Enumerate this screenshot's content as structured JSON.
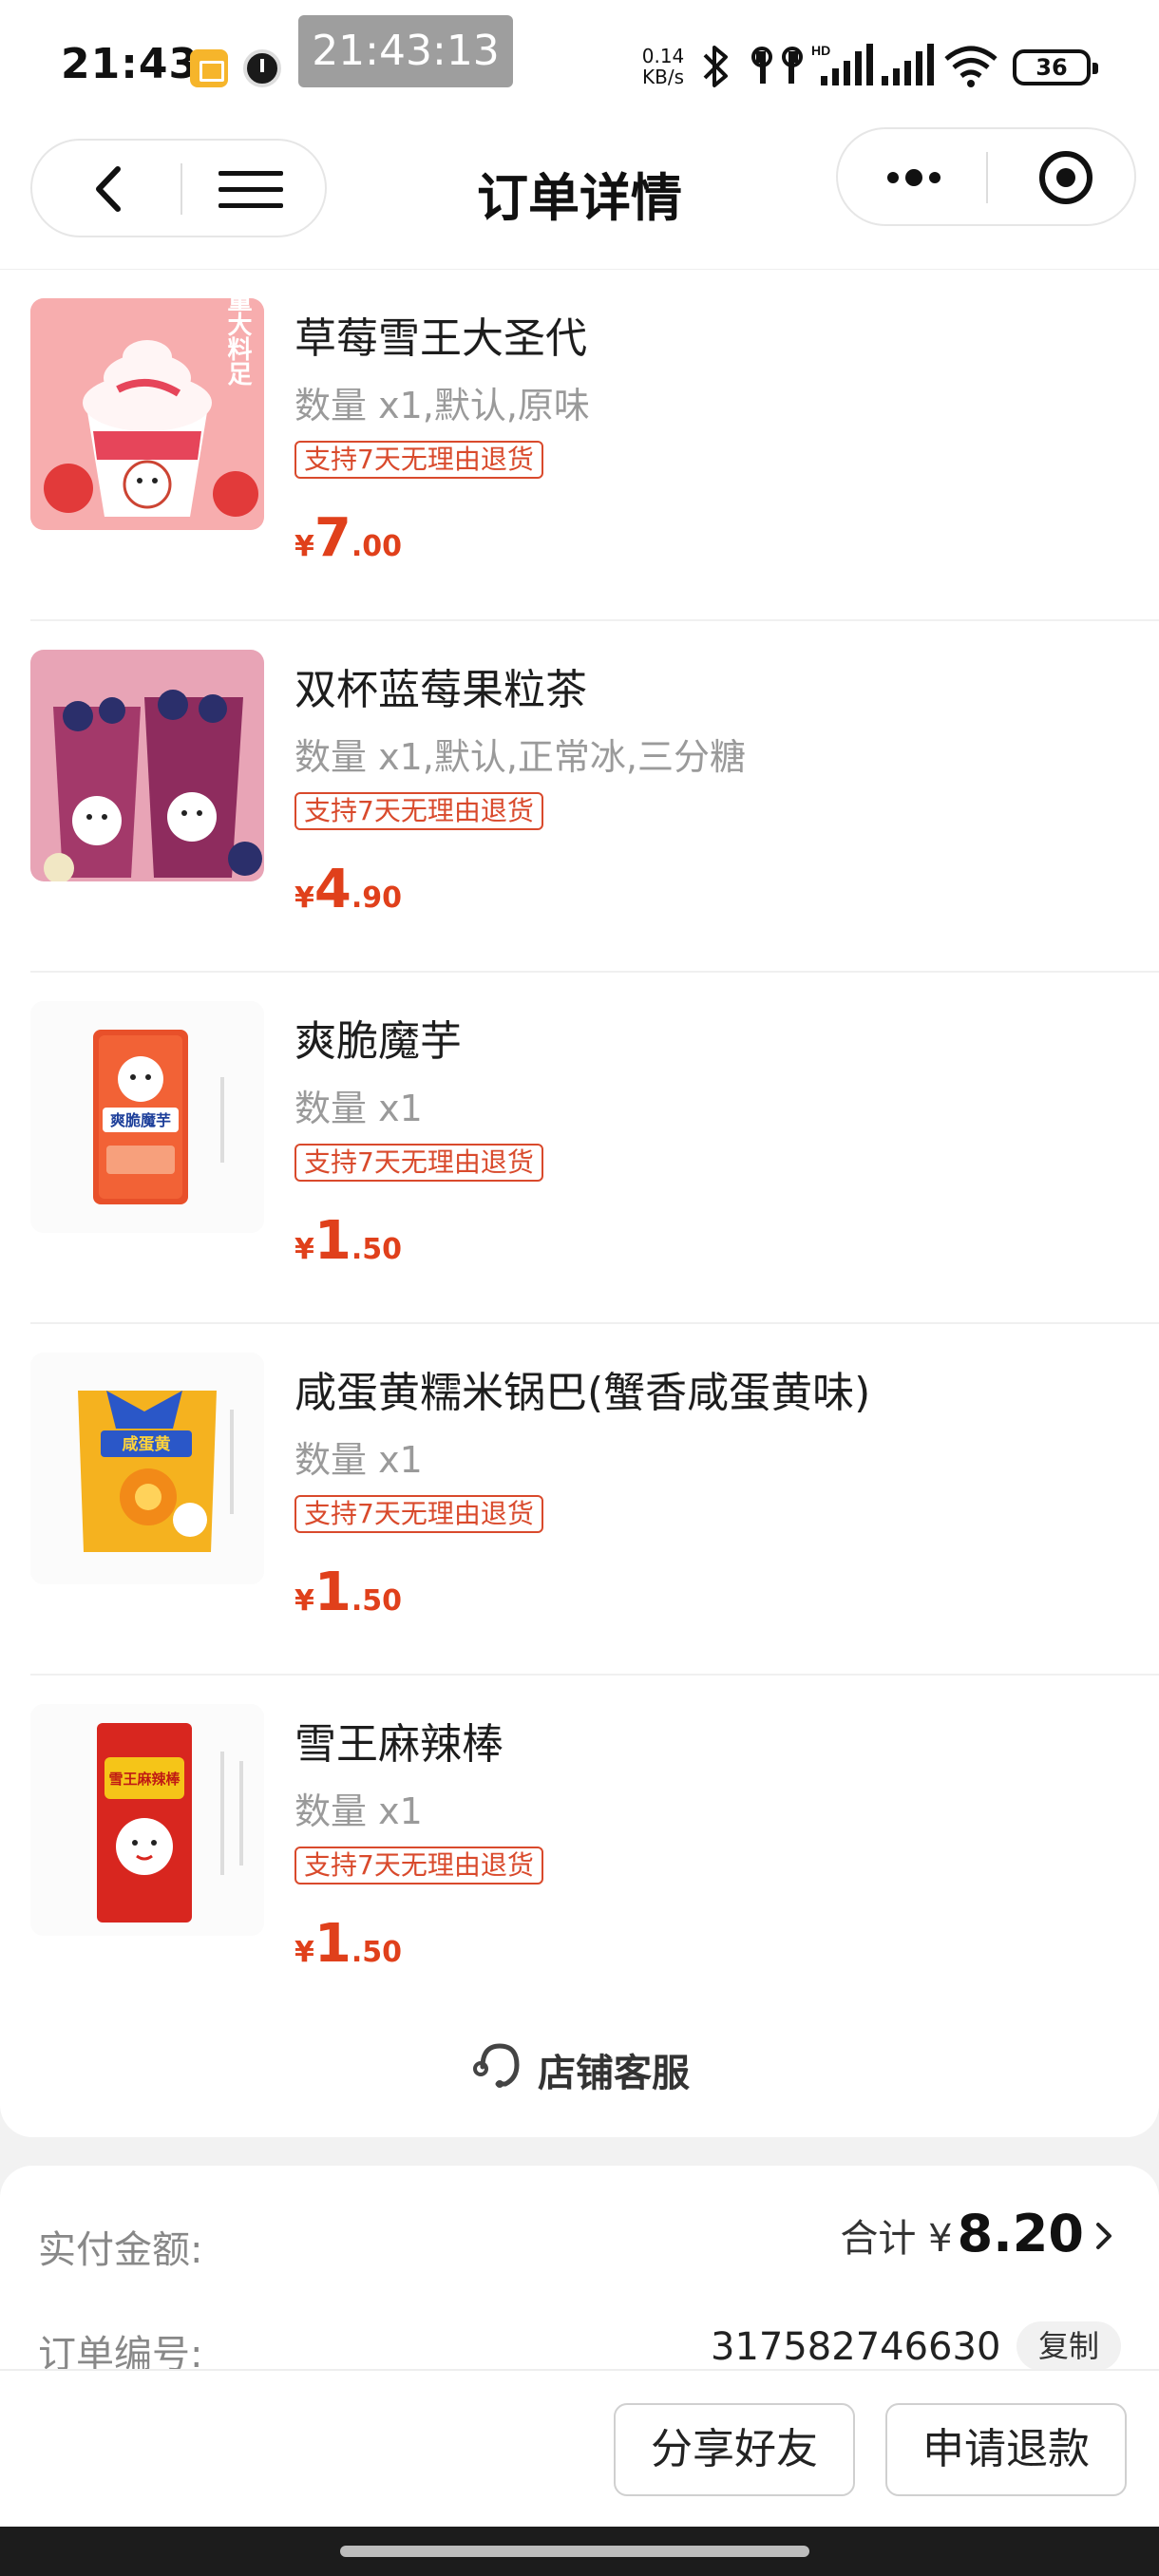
{
  "status_bar": {
    "time": "21:43",
    "clock_badge": "21:43:13",
    "net_speed_value": "0.14",
    "net_speed_unit": "KB/s",
    "hd_label": "HD",
    "battery": "36"
  },
  "nav": {
    "title": "订单详情"
  },
  "items": [
    {
      "name": "草莓雪王大圣代",
      "spec": "数量 x1,默认,原味",
      "tag": "支持7天无理由退货",
      "currency": "¥",
      "price_int": "7",
      "price_dec": ".00",
      "thumb_text": "量大料足"
    },
    {
      "name": "双杯蓝莓果粒茶",
      "spec": "数量 x1,默认,正常冰,三分糖",
      "tag": "支持7天无理由退货",
      "currency": "¥",
      "price_int": "4",
      "price_dec": ".90"
    },
    {
      "name": "爽脆魔芋",
      "spec": "数量 x1",
      "tag": "支持7天无理由退货",
      "currency": "¥",
      "price_int": "1",
      "price_dec": ".50",
      "thumb_text": "爽脆魔芋"
    },
    {
      "name": "咸蛋黄糯米锅巴(蟹香咸蛋黄味)",
      "spec": "数量 x1",
      "tag": "支持7天无理由退货",
      "currency": "¥",
      "price_int": "1",
      "price_dec": ".50",
      "thumb_text": "咸蛋黄"
    },
    {
      "name": "雪王麻辣棒",
      "spec": "数量 x1",
      "tag": "支持7天无理由退货",
      "currency": "¥",
      "price_int": "1",
      "price_dec": ".50",
      "thumb_text": "雪王麻辣棒"
    }
  ],
  "service": {
    "label": "店铺客服"
  },
  "summary": {
    "paid_label": "实付金额:",
    "total_prefix": "合计 ¥",
    "total_amount": "8.20",
    "order_no_label": "订单编号:",
    "order_no": "317582746630",
    "copy_label": "复制"
  },
  "actions": {
    "share_label": "分享好友",
    "refund_label": "申请退款"
  },
  "colors": {
    "price_red": "#e0401b",
    "tag_red": "#d94a2c"
  }
}
